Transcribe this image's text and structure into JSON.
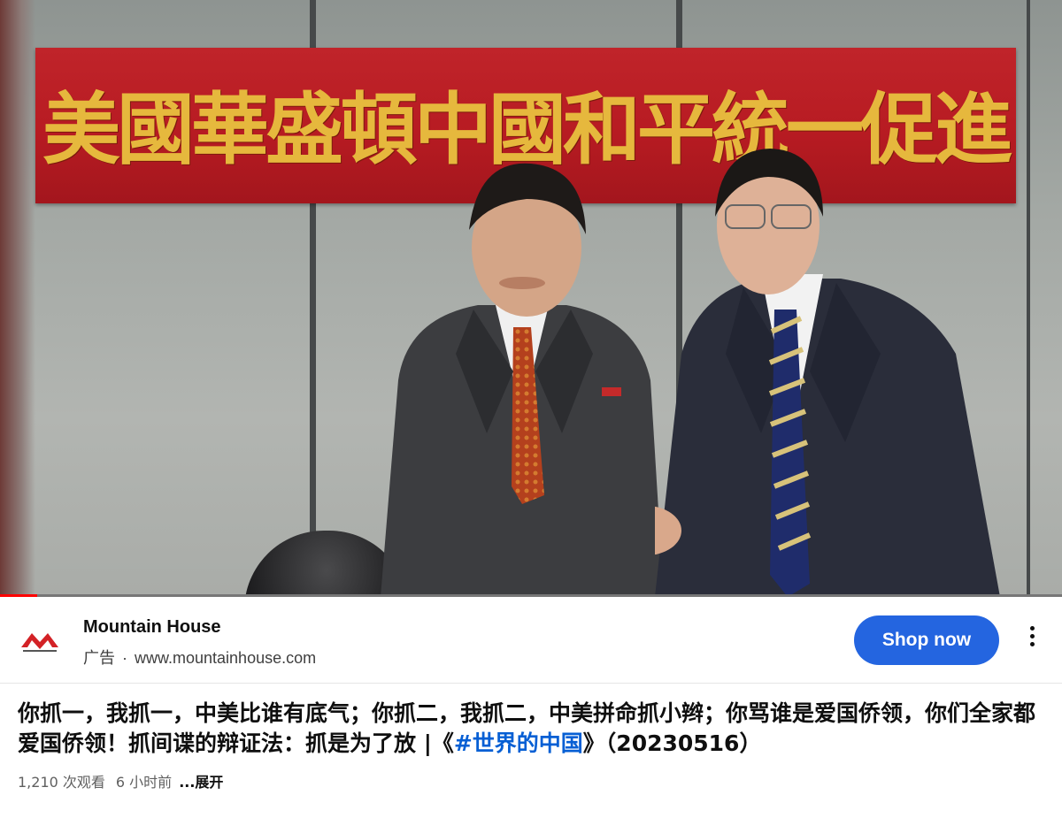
{
  "video": {
    "banner_text": "美國華盛頓中國和平統一促進會",
    "progress": 0.035
  },
  "ad": {
    "brand": "Mountain House",
    "label": "广告",
    "separator": "·",
    "url": "www.mountainhouse.com",
    "cta": "Shop now",
    "logo_icon": "mountain-house-logo",
    "menu_icon": "more-vert-icon"
  },
  "title": {
    "text": "你抓一，我抓一，中美比谁有底气；你抓二，我抓二，中美拼命抓小辫；你骂谁是爱国侨领，你们全家都爱国侨领！抓间谍的辩证法：抓是为了放 |《",
    "hashtag": "#世界的中国",
    "suffix": "》（20230516）"
  },
  "meta": {
    "views": "1,210 次观看",
    "time": "6 小时前",
    "expand": "...展开"
  },
  "colors": {
    "accent": "#2465e0",
    "link": "#065fd4",
    "progress": "#ff0000",
    "banner": "#c0242a",
    "banner_text": "#e6b83d"
  }
}
